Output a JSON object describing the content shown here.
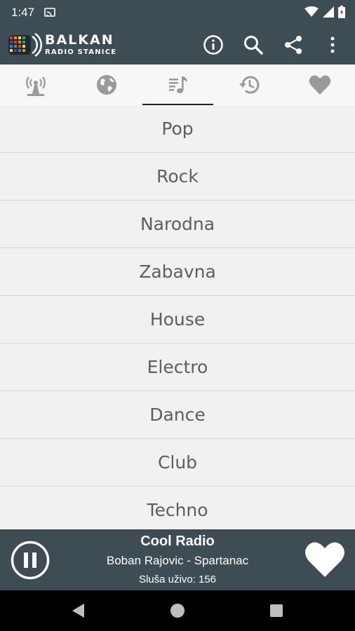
{
  "status_bar": {
    "time": "1:47"
  },
  "app": {
    "title_line1": "BALKAN",
    "title_line2": "RADIO STANICE"
  },
  "tabs": [
    {
      "icon": "antenna-icon"
    },
    {
      "icon": "globe-icon"
    },
    {
      "icon": "music-genre-icon",
      "selected": true
    },
    {
      "icon": "history-icon"
    },
    {
      "icon": "heart-icon"
    }
  ],
  "genres": [
    "Pop",
    "Rock",
    "Narodna",
    "Zabavna",
    "House",
    "Electro",
    "Dance",
    "Club",
    "Techno"
  ],
  "player": {
    "station": "Cool Radio",
    "song": "Boban Rajovic - Spartanac",
    "listeners": "Sluša uživo: 156"
  },
  "colors": {
    "bar": "#3e4c53",
    "list_bg": "#f1f1f1",
    "row_text": "#5e5e5e",
    "divider": "#d6d6d6"
  }
}
